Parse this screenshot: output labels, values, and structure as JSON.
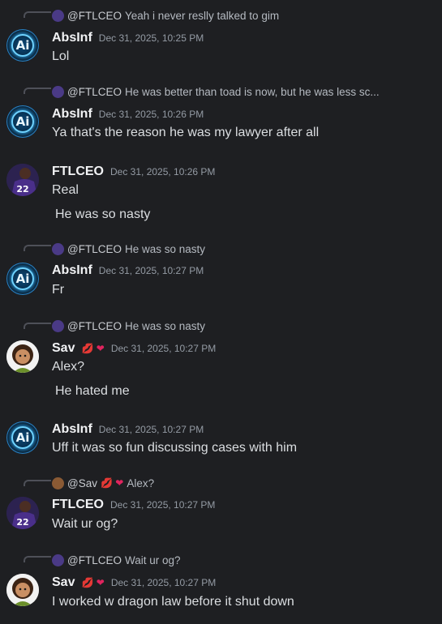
{
  "messages": [
    {
      "reply": {
        "mention": "@FTLCEO",
        "text": "Yeah i never reslly talked to gim"
      },
      "author": "AbsInf",
      "time": "Dec 31, 2025, 10:25 PM",
      "lines": [
        "Lol"
      ]
    },
    {
      "reply": {
        "mention": "@FTLCEO",
        "text": "He was better than toad is now, but he was less sc..."
      },
      "author": "AbsInf",
      "time": "Dec 31, 2025, 10:26 PM",
      "lines": [
        "Ya that's the reason he was my lawyer after all"
      ]
    },
    {
      "author": "FTLCEO",
      "time": "Dec 31, 2025, 10:26 PM",
      "lines": [
        "Real",
        "He was so nasty"
      ]
    },
    {
      "reply": {
        "mention": "@FTLCEO",
        "text": "He was so nasty"
      },
      "author": "AbsInf",
      "time": "Dec 31, 2025, 10:27 PM",
      "lines": [
        "Fr"
      ]
    },
    {
      "reply": {
        "mention": "@FTLCEO",
        "text": "He was so nasty"
      },
      "author": "Sav",
      "author_emoji": "💋 ❤",
      "time": "Dec 31, 2025, 10:27 PM",
      "lines": [
        "Alex?",
        "He hated me"
      ]
    },
    {
      "author": "AbsInf",
      "time": "Dec 31, 2025, 10:27 PM",
      "lines": [
        "Uff it was so fun discussing cases with him"
      ]
    },
    {
      "reply": {
        "mention": "@Sav",
        "mention_emoji": "💋 ❤",
        "text": "Alex?"
      },
      "author": "FTLCEO",
      "time": "Dec 31, 2025, 10:27 PM",
      "lines": [
        "Wait ur og?"
      ]
    },
    {
      "reply": {
        "mention": "@FTLCEO",
        "text": "Wait ur og?"
      },
      "author": "Sav",
      "author_emoji": "💋 ❤",
      "time": "Dec 31, 2025, 10:27 PM",
      "lines": [
        "I worked w dragon law before it shut down"
      ]
    }
  ],
  "avatars": {
    "ai_text": "Ai",
    "jersey": "22"
  },
  "colors": {
    "background": "#1e1f22",
    "text": "#dbdee1",
    "timestamp": "#949ba4",
    "reply_line": "#4e5058"
  }
}
